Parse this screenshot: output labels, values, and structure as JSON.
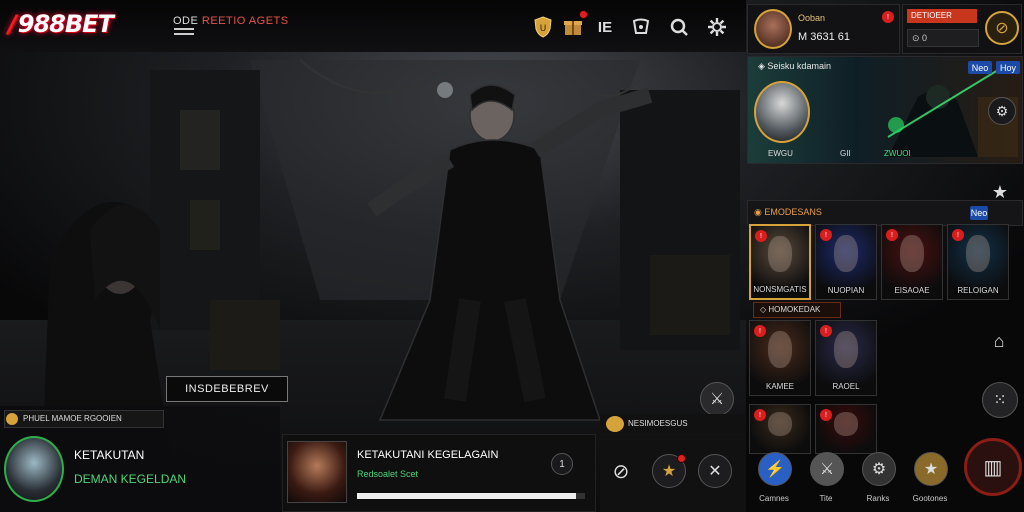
{
  "brand": {
    "logo_text": "988BET",
    "menu_prefix": "ODE",
    "menu_highlight": "REETIO AGETS"
  },
  "topbar_icons": [
    "shield-icon",
    "gift-icon",
    "building-icon",
    "mail-icon",
    "search-icon",
    "settings-icon"
  ],
  "profile": {
    "level": "Ooban",
    "stats": "M 3631 61",
    "rank_label": "DETIOEER",
    "balance_label": "0"
  },
  "featured": {
    "title": "Seisku kdamain",
    "badge1": "Neo",
    "badge2": "Hoy",
    "labels": [
      "EWGU",
      "GII",
      "ZWUOI"
    ]
  },
  "scene_caption": "INSDEBEBREV",
  "bottom_left": {
    "label": "PHUEL MAMOE RGOOIEN",
    "title": "KETAKUTAN",
    "subtitle": "DEMAN KEGELDAN"
  },
  "now_playing": {
    "title": "KETAKUTANI KEGELAGAIN",
    "subtitle": "Redsoalet Scet",
    "count": "1",
    "progress": 0.96,
    "section": "NESIMOESGUS"
  },
  "characters": {
    "header": "EMODESANS",
    "badge": "Neo",
    "row1": [
      {
        "name": "NONSMGATIS",
        "color": "#5a4a3a"
      },
      {
        "name": "NUOPIAN",
        "color": "#1c2a6b"
      },
      {
        "name": "EISAOAE",
        "color": "#4a1010"
      },
      {
        "name": "RELOIGAN",
        "color": "#123048"
      }
    ],
    "row2_header": "HOMOKEDAK",
    "row2": [
      {
        "name": "KAMEE",
        "color": "#4a2a1a"
      },
      {
        "name": "RAOEL",
        "color": "#2a2a4a"
      }
    ],
    "row3": [
      {
        "name": "",
        "color": "#3a2a1a"
      },
      {
        "name": "",
        "color": "#3a0a0a"
      }
    ]
  },
  "bottom_nav": [
    {
      "label": "Camnes"
    },
    {
      "label": "Tite"
    },
    {
      "label": "Ranks"
    },
    {
      "label": "Gootones"
    }
  ],
  "colors": {
    "accent_red": "#d81e1e",
    "blue": "#1c4aa8",
    "gold": "#d6a23a"
  }
}
